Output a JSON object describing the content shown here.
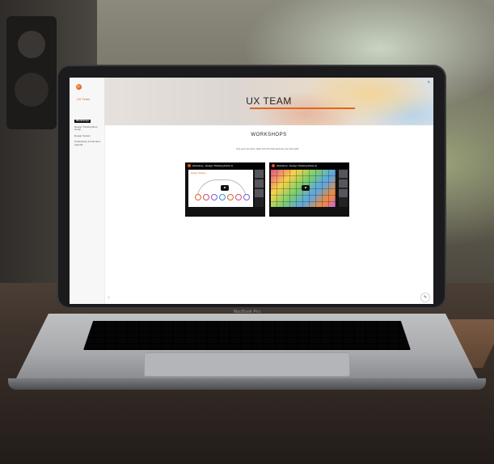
{
  "device": {
    "label": "MacBook Pro"
  },
  "site": {
    "name": "UX Team",
    "nav": [
      {
        "label": "Workshops",
        "active": true
      },
      {
        "label": "Design Thinking Boot Camp",
        "active": false
      },
      {
        "label": "Design System",
        "active": false
      },
      {
        "label": "Productivity & Unlimited Agenda",
        "active": false
      }
    ],
    "banner_title": "UX TEAM",
    "banner_edit_icon": "edit-icon"
  },
  "main": {
    "section_title": "WORKSHOPS",
    "intro": "Use your own time, learn from the best and use your time well.",
    "videos": [
      {
        "title": "Workshop - Design Thinking (Parte 1)",
        "slide_label": "Design Thinking"
      },
      {
        "title": "Workshop - Design Thinking (Parte 2)"
      }
    ]
  },
  "footer": {
    "text": "",
    "left_icon": "info-icon"
  },
  "colors": {
    "accent": "#e2641f"
  }
}
